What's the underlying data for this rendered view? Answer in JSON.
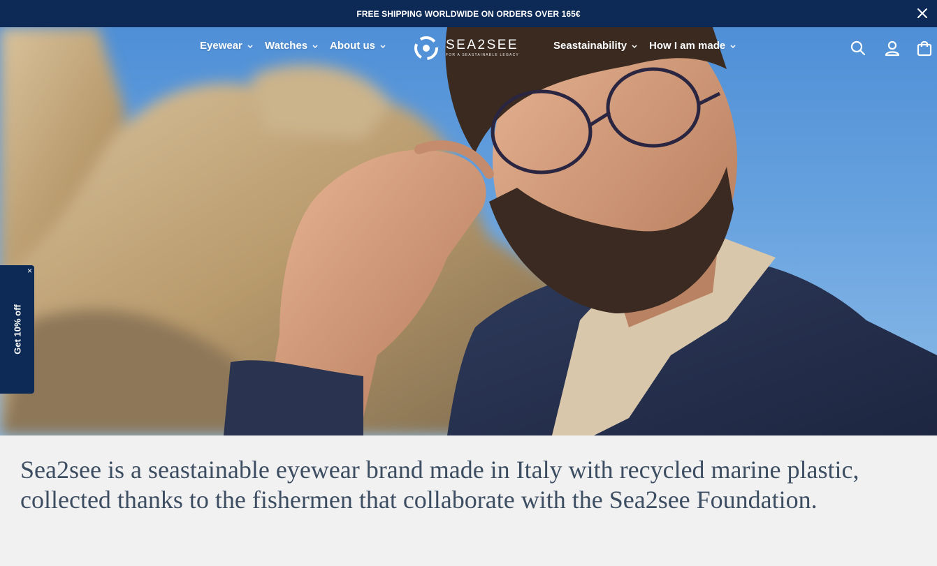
{
  "announcement": {
    "text": "FREE SHIPPING WORLDWIDE ON ORDERS OVER 165€",
    "close_icon": "close-icon"
  },
  "nav": {
    "left_items": [
      {
        "label": "Eyewear",
        "icon": "chevron-down-icon"
      },
      {
        "label": "Watches",
        "icon": "chevron-down-icon"
      },
      {
        "label": "About us",
        "icon": "chevron-down-icon"
      }
    ],
    "logo": {
      "brand": "SEA2SEE",
      "tagline": "FOR A SEASTAINABLE LEGACY",
      "icon": "sea2see-logo-icon"
    },
    "right_items": [
      {
        "label": "Seastainability",
        "icon": "chevron-down-icon"
      },
      {
        "label": "How I am made",
        "icon": "chevron-down-icon"
      }
    ],
    "utility_icons": [
      "search-icon",
      "account-icon",
      "cart-icon"
    ]
  },
  "promo": {
    "label": "Get 10% off",
    "close": "×"
  },
  "intro": {
    "text": "Sea2see is a seastainable eyewear brand made in Italy with recycled marine plastic, collected thanks to the fishermen that collaborate with the Sea2see Foundation."
  },
  "colors": {
    "navy": "#0c2a55",
    "intro_text": "#3d4e63",
    "section_bg": "#f1f1f1"
  }
}
